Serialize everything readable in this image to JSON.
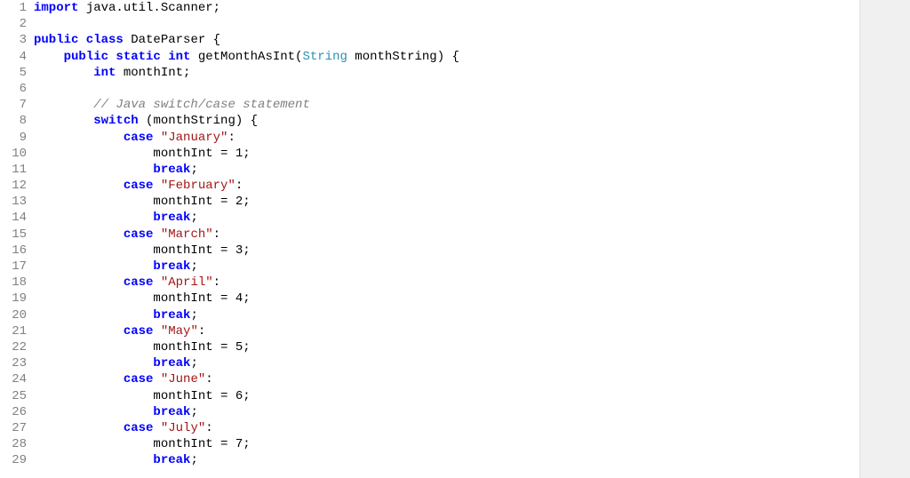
{
  "code_lines": [
    {
      "num": 1,
      "tokens": [
        {
          "t": "import",
          "c": "keyword"
        },
        {
          "t": " java.util.Scanner;",
          "c": ""
        }
      ]
    },
    {
      "num": 2,
      "tokens": [
        {
          "t": "",
          "c": ""
        }
      ]
    },
    {
      "num": 3,
      "tokens": [
        {
          "t": "public class",
          "c": "keyword"
        },
        {
          "t": " DateParser {",
          "c": ""
        }
      ]
    },
    {
      "num": 4,
      "tokens": [
        {
          "t": "    ",
          "c": ""
        },
        {
          "t": "public static int",
          "c": "keyword"
        },
        {
          "t": " getMonthAsInt(",
          "c": ""
        },
        {
          "t": "String",
          "c": "class-type"
        },
        {
          "t": " monthString) {",
          "c": ""
        }
      ]
    },
    {
      "num": 5,
      "tokens": [
        {
          "t": "        ",
          "c": ""
        },
        {
          "t": "int",
          "c": "keyword"
        },
        {
          "t": " monthInt;",
          "c": ""
        }
      ]
    },
    {
      "num": 6,
      "tokens": [
        {
          "t": "",
          "c": ""
        }
      ]
    },
    {
      "num": 7,
      "tokens": [
        {
          "t": "        ",
          "c": ""
        },
        {
          "t": "// Java switch/case statement",
          "c": "comment"
        }
      ]
    },
    {
      "num": 8,
      "tokens": [
        {
          "t": "        ",
          "c": ""
        },
        {
          "t": "switch",
          "c": "keyword"
        },
        {
          "t": " (monthString) {",
          "c": ""
        }
      ]
    },
    {
      "num": 9,
      "tokens": [
        {
          "t": "            ",
          "c": ""
        },
        {
          "t": "case",
          "c": "keyword"
        },
        {
          "t": " ",
          "c": ""
        },
        {
          "t": "\"January\"",
          "c": "string"
        },
        {
          "t": ":",
          "c": ""
        }
      ]
    },
    {
      "num": 10,
      "tokens": [
        {
          "t": "                monthInt = 1;",
          "c": ""
        }
      ]
    },
    {
      "num": 11,
      "tokens": [
        {
          "t": "                ",
          "c": ""
        },
        {
          "t": "break",
          "c": "keyword"
        },
        {
          "t": ";",
          "c": ""
        }
      ]
    },
    {
      "num": 12,
      "tokens": [
        {
          "t": "            ",
          "c": ""
        },
        {
          "t": "case",
          "c": "keyword"
        },
        {
          "t": " ",
          "c": ""
        },
        {
          "t": "\"February\"",
          "c": "string"
        },
        {
          "t": ":",
          "c": ""
        }
      ]
    },
    {
      "num": 13,
      "tokens": [
        {
          "t": "                monthInt = 2;",
          "c": ""
        }
      ]
    },
    {
      "num": 14,
      "tokens": [
        {
          "t": "                ",
          "c": ""
        },
        {
          "t": "break",
          "c": "keyword"
        },
        {
          "t": ";",
          "c": ""
        }
      ]
    },
    {
      "num": 15,
      "tokens": [
        {
          "t": "            ",
          "c": ""
        },
        {
          "t": "case",
          "c": "keyword"
        },
        {
          "t": " ",
          "c": ""
        },
        {
          "t": "\"March\"",
          "c": "string"
        },
        {
          "t": ":",
          "c": ""
        }
      ]
    },
    {
      "num": 16,
      "tokens": [
        {
          "t": "                monthInt = 3;",
          "c": ""
        }
      ]
    },
    {
      "num": 17,
      "tokens": [
        {
          "t": "                ",
          "c": ""
        },
        {
          "t": "break",
          "c": "keyword"
        },
        {
          "t": ";",
          "c": ""
        }
      ]
    },
    {
      "num": 18,
      "tokens": [
        {
          "t": "            ",
          "c": ""
        },
        {
          "t": "case",
          "c": "keyword"
        },
        {
          "t": " ",
          "c": ""
        },
        {
          "t": "\"April\"",
          "c": "string"
        },
        {
          "t": ":",
          "c": ""
        }
      ]
    },
    {
      "num": 19,
      "tokens": [
        {
          "t": "                monthInt = 4;",
          "c": ""
        }
      ]
    },
    {
      "num": 20,
      "tokens": [
        {
          "t": "                ",
          "c": ""
        },
        {
          "t": "break",
          "c": "keyword"
        },
        {
          "t": ";",
          "c": ""
        }
      ]
    },
    {
      "num": 21,
      "tokens": [
        {
          "t": "            ",
          "c": ""
        },
        {
          "t": "case",
          "c": "keyword"
        },
        {
          "t": " ",
          "c": ""
        },
        {
          "t": "\"May\"",
          "c": "string"
        },
        {
          "t": ":",
          "c": ""
        }
      ]
    },
    {
      "num": 22,
      "tokens": [
        {
          "t": "                monthInt = 5;",
          "c": ""
        }
      ]
    },
    {
      "num": 23,
      "tokens": [
        {
          "t": "                ",
          "c": ""
        },
        {
          "t": "break",
          "c": "keyword"
        },
        {
          "t": ";",
          "c": ""
        }
      ]
    },
    {
      "num": 24,
      "tokens": [
        {
          "t": "            ",
          "c": ""
        },
        {
          "t": "case",
          "c": "keyword"
        },
        {
          "t": " ",
          "c": ""
        },
        {
          "t": "\"June\"",
          "c": "string"
        },
        {
          "t": ":",
          "c": ""
        }
      ]
    },
    {
      "num": 25,
      "tokens": [
        {
          "t": "                monthInt = 6;",
          "c": ""
        }
      ]
    },
    {
      "num": 26,
      "tokens": [
        {
          "t": "                ",
          "c": ""
        },
        {
          "t": "break",
          "c": "keyword"
        },
        {
          "t": ";",
          "c": ""
        }
      ]
    },
    {
      "num": 27,
      "tokens": [
        {
          "t": "            ",
          "c": ""
        },
        {
          "t": "case",
          "c": "keyword"
        },
        {
          "t": " ",
          "c": ""
        },
        {
          "t": "\"July\"",
          "c": "string"
        },
        {
          "t": ":",
          "c": ""
        }
      ]
    },
    {
      "num": 28,
      "tokens": [
        {
          "t": "                monthInt = 7;",
          "c": ""
        }
      ]
    },
    {
      "num": 29,
      "tokens": [
        {
          "t": "                ",
          "c": ""
        },
        {
          "t": "break",
          "c": "keyword"
        },
        {
          "t": ";",
          "c": ""
        }
      ]
    }
  ]
}
